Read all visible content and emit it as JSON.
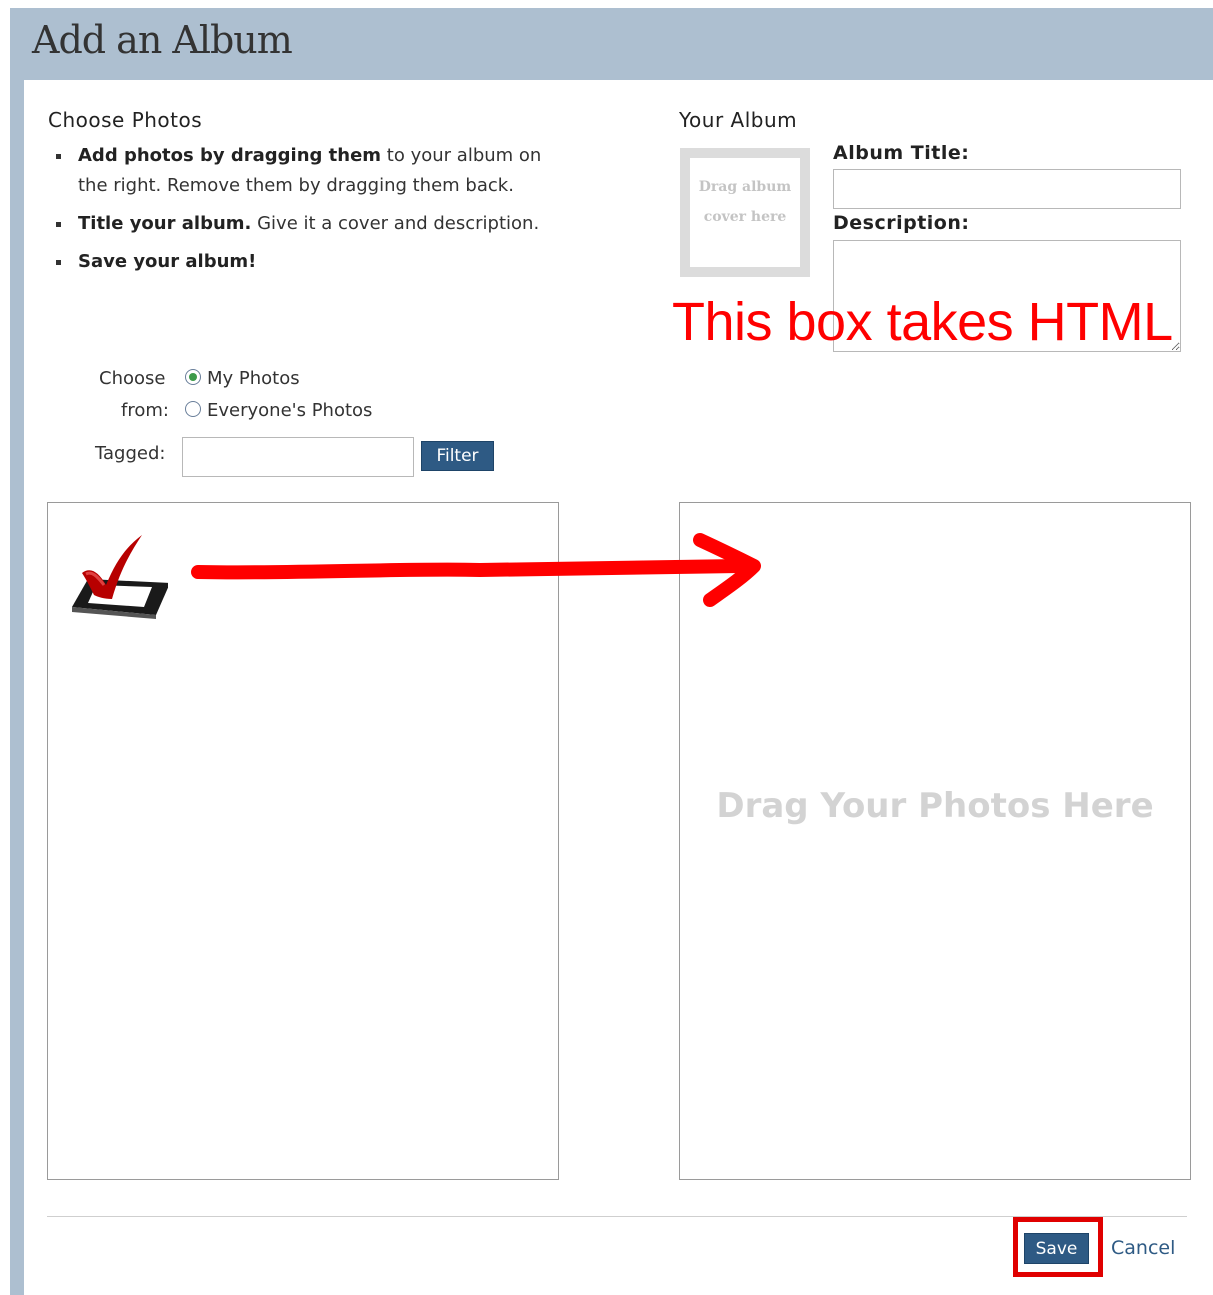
{
  "window": {
    "title": "Add an Album"
  },
  "choose_section": {
    "heading": "Choose Photos",
    "instructions": [
      {
        "bold": "Add photos by dragging them",
        "rest": " to your album on the right. Remove them by dragging them back."
      },
      {
        "bold": "Title your album.",
        "rest": " Give it a cover and description."
      },
      {
        "bold": "Save your album!",
        "rest": ""
      }
    ],
    "choose_label_1": "Choose",
    "choose_label_2": "from:",
    "source_options": [
      {
        "label": "My Photos",
        "selected": true
      },
      {
        "label": "Everyone's Photos",
        "selected": false
      }
    ],
    "tagged_label": "Tagged:",
    "tagged_value": "",
    "filter_button": "Filter"
  },
  "album_section": {
    "heading": "Your Album",
    "cover_drop_line1": "Drag album",
    "cover_drop_line2": "cover here",
    "title_label": "Album Title:",
    "title_value": "",
    "description_label": "Description:",
    "description_value": "",
    "album_drop_hint": "Drag Your Photos Here"
  },
  "annotation": {
    "text": "This box takes HTML",
    "color": "#ff0000"
  },
  "footer": {
    "save_button": "Save",
    "cancel_link": "Cancel"
  },
  "colors": {
    "title_bar": "#adbfd0",
    "button": "#2e5a84",
    "annotation": "#ff0000"
  },
  "icons": {
    "photo_thumbnail": "checkmark-checkbox-icon",
    "drag_arrow": "red-right-arrow"
  }
}
